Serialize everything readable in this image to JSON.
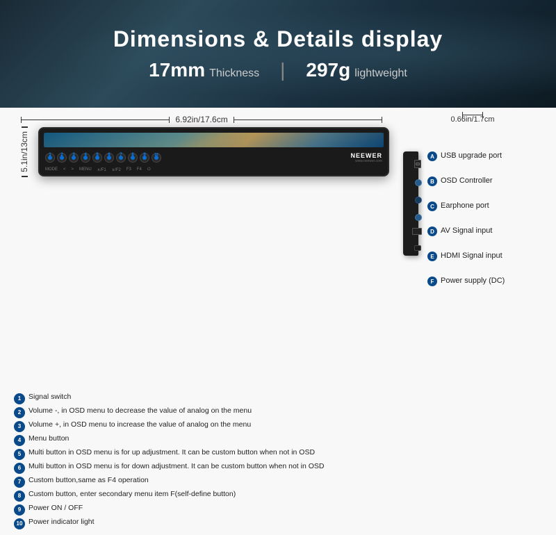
{
  "header": {
    "title": "Dimensions & Details display",
    "thickness_value": "17mm",
    "thickness_unit": "Thickness",
    "weight_value": "297g",
    "weight_unit": "lightweight",
    "divider": "|"
  },
  "dimensions": {
    "width_label": "6.92in/17.6cm",
    "height_label": "5.1in/13cm",
    "side_width_label": "0.66in/1.7cm"
  },
  "left_labels": [
    {
      "num": "1",
      "text": "Signal switch"
    },
    {
      "num": "2",
      "text": "Volume -, in OSD  menu to decrease the value of analog on the menu"
    },
    {
      "num": "3",
      "text": "Volume +, in OSD  menu to increase the value of analog on the menu"
    },
    {
      "num": "4",
      "text": "Menu button"
    },
    {
      "num": "5",
      "text": "Multi button in OSD menu is for up adjustment. It can be custom button when not in OSD"
    },
    {
      "num": "6",
      "text": "Multi button in OSD menu is for down adjustment. It can be custom button when not in OSD"
    },
    {
      "num": "7",
      "text": "Custom button,same as F4 operation"
    },
    {
      "num": "8",
      "text": "Custom button, enter secondary menu item F(self-define button)"
    },
    {
      "num": "9",
      "text": "Power ON / OFF"
    },
    {
      "num": "10",
      "text": "Power indicator light"
    }
  ],
  "right_labels": [
    {
      "letter": "A",
      "text": "USB upgrade port"
    },
    {
      "letter": "B",
      "text": "OSD Controller"
    },
    {
      "letter": "C",
      "text": "Earphone port"
    },
    {
      "letter": "D",
      "text": "AV Signal input"
    },
    {
      "letter": "E",
      "text": "HDMI Signal input"
    },
    {
      "letter": "F",
      "text": "Power supply (DC)"
    }
  ],
  "monitor": {
    "brand": "NEEWER",
    "website": "www.neewer.com",
    "mode_labels": [
      "MODE",
      "<",
      ">",
      "MENU",
      "∧/F1",
      "∨/F2",
      "F3",
      "F4",
      "⏻"
    ]
  }
}
